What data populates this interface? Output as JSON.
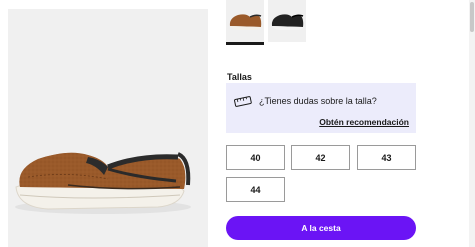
{
  "sizes": {
    "label": "Tallas",
    "options": [
      "40",
      "42",
      "43",
      "44"
    ]
  },
  "fit_help": {
    "question": "¿Tienes dudas sobre la talla?",
    "link": "Obtén recomendación",
    "icon": "measuring-tape-icon"
  },
  "cart": {
    "label": "A la cesta"
  },
  "colors": {
    "accent": "#6b14f5",
    "fit_box_bg": "#ececfb"
  }
}
